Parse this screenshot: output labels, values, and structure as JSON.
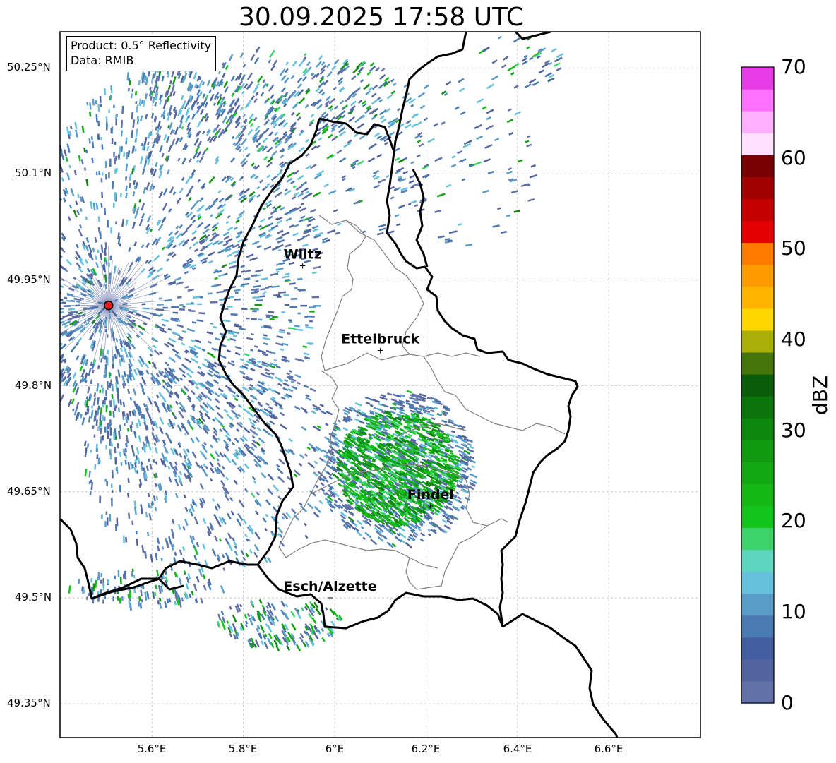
{
  "title": "30.09.2025 17:58 UTC",
  "info_box": {
    "product": "Product: 0.5° Reflectivity",
    "data": "Data: RMIB"
  },
  "latitude_labels": [
    "50.25°N",
    "50.1°N",
    "49.95°N",
    "49.8°N",
    "49.65°N",
    "49.5°N",
    "49.35°N"
  ],
  "longitude_labels": [
    "5.6°E",
    "5.8°E",
    "6°E",
    "6.2°E",
    "6.4°E",
    "6.6°E"
  ],
  "cities": [
    {
      "name": "Wiltz",
      "lon": 5.93,
      "lat": 49.97
    },
    {
      "name": "Ettelbruck",
      "lon": 6.1,
      "lat": 49.85
    },
    {
      "name": "Findel",
      "lon": 6.21,
      "lat": 49.63
    },
    {
      "name": "Esch/Alzette",
      "lon": 5.99,
      "lat": 49.5
    }
  ],
  "radar_site": {
    "lon": 5.505,
    "lat": 49.914,
    "color": "#e41a1c"
  },
  "colorbar": {
    "label": "dBZ",
    "min": 0,
    "max": 70,
    "ticks": [
      "0",
      "10",
      "20",
      "30",
      "40",
      "50",
      "60",
      "70"
    ],
    "colors": [
      "#6272a8",
      "#5264a0",
      "#435ea0",
      "#4a7ab2",
      "#5a9cc8",
      "#66c2dc",
      "#5dd6c0",
      "#3dd46c",
      "#12c41c",
      "#14b814",
      "#12a812",
      "#0f9a0f",
      "#0d860d",
      "#0b740b",
      "#0a5c0a",
      "#44740a",
      "#aab00a",
      "#ffd700",
      "#ffb400",
      "#ff9a00",
      "#ff7c00",
      "#e40000",
      "#c40000",
      "#a00000",
      "#780000",
      "#ffe0ff",
      "#ffb0ff",
      "#ff70ff",
      "#e83ce8"
    ]
  }
}
